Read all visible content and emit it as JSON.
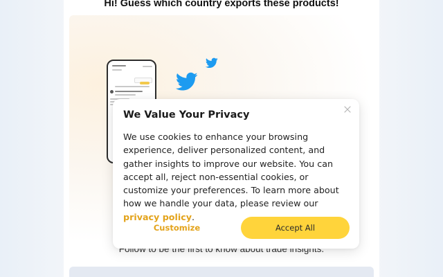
{
  "page": {
    "headline": "Hi! Guess which country exports these products!",
    "follow_text": "Follow to be the first to know about trade insights."
  },
  "promo": {
    "icons": [
      "phone-mockup",
      "twitter-bird-icon",
      "twitter-bird-icon"
    ],
    "twitter_color": "#1d9bf0"
  },
  "cookie_modal": {
    "title": "We Value Your Privacy",
    "body_text": "We use cookies to enhance your browsing experience, deliver personalized content, and gather insights to improve our website. You can accept all, reject non-essential cookies, or customize your preferences. To learn more about how we handle your data, please review our",
    "link_text": "privacy policy",
    "trailing": ".",
    "customize_label": "Customize",
    "accept_label": "Accept All",
    "close_icon": "close-icon",
    "accent_color": "#e3a31b",
    "accept_bg": "#ffd43b"
  }
}
